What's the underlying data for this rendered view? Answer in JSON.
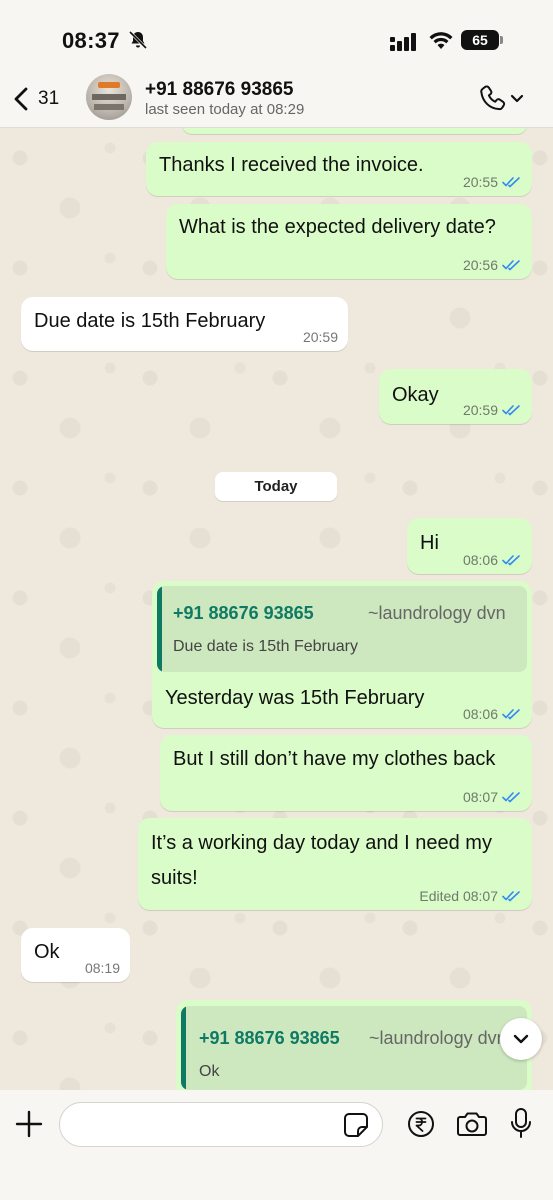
{
  "status_bar": {
    "time": "08:37",
    "battery": "65"
  },
  "header": {
    "back_count": "31",
    "contact_name": "+91 88676 93865",
    "last_seen": "last seen today at 08:29"
  },
  "messages": [
    {
      "text": "Thanks I received the invoice.",
      "time": "20:55"
    },
    {
      "text": "What is the expected delivery date?",
      "time": "20:56"
    },
    {
      "text": "Due date is 15th February",
      "time": "20:59"
    },
    {
      "text": "Okay",
      "time": "20:59"
    },
    {
      "text": "Hi",
      "time": "08:06"
    },
    {
      "quote_name": "+91 88676 93865",
      "quote_alias": "~laundrology dvn",
      "quote_text": "Due date is 15th February",
      "text": "Yesterday was 15th February",
      "time": "08:06"
    },
    {
      "text": "But I still don’t have my clothes back",
      "time": "08:07"
    },
    {
      "text_line1": "It’s a working day today and I need my",
      "text_line2": "suits!",
      "time": "Edited 08:07"
    },
    {
      "text": "Ok",
      "time": "08:19"
    },
    {
      "quote_name": "+91 88676 93865",
      "quote_alias": "~laundrology dvn",
      "quote_text": "Ok"
    }
  ],
  "day_separator": "Today",
  "input": {
    "placeholder": ""
  },
  "colors": {
    "outgoing_bubble": "#dafcc8",
    "incoming_bubble": "#ffffff",
    "read_ticks": "#2f8cf0",
    "quote_accent": "#0f7a63"
  },
  "icons": [
    "bell-off-icon",
    "signal-icon",
    "wifi-icon",
    "back-chevron-icon",
    "phone-icon",
    "chevron-down-icon",
    "double-check-icon",
    "plus-icon",
    "sticker-icon",
    "rupee-icon",
    "camera-icon",
    "microphone-icon"
  ]
}
